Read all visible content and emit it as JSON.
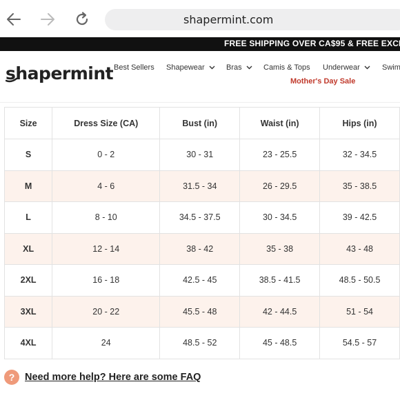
{
  "browser": {
    "url": "shapermint.com",
    "back_icon": "arrow-left-icon",
    "forward_icon": "arrow-right-icon",
    "reload_icon": "reload-icon"
  },
  "promo": {
    "text": "FREE SHIPPING OVER CA$95 & FREE EXCH"
  },
  "header": {
    "logo_text": "shapermint",
    "menu": [
      {
        "label": "Best Sellers",
        "has_dropdown": false
      },
      {
        "label": "Shapewear",
        "has_dropdown": true
      },
      {
        "label": "Bras",
        "has_dropdown": true
      },
      {
        "label": "Camis & Tops",
        "has_dropdown": false
      },
      {
        "label": "Underwear",
        "has_dropdown": true
      },
      {
        "label": "Swim",
        "has_dropdown": false
      }
    ],
    "sale_link": "Mother's Day Sale",
    "sale_color": "#c0392b"
  },
  "table": {
    "headers": [
      "Size",
      "Dress Size (CA)",
      "Bust (in)",
      "Waist (in)",
      "Hips (in)"
    ],
    "rows": [
      [
        "S",
        "0 - 2",
        "30 - 31",
        "23 - 25.5",
        "32 - 34.5"
      ],
      [
        "M",
        "4 - 6",
        "31.5 - 34",
        "26 - 29.5",
        "35 - 38.5"
      ],
      [
        "L",
        "8 - 10",
        "34.5 - 37.5",
        "30 - 34.5",
        "39 - 42.5"
      ],
      [
        "XL",
        "12 - 14",
        "38 - 42",
        "35 - 38",
        "43 - 48"
      ],
      [
        "2XL",
        "16 - 18",
        "42.5 - 45",
        "38.5 - 41.5",
        "48.5 - 50.5"
      ],
      [
        "3XL",
        "20 - 22",
        "45.5 - 48",
        "42 - 44.5",
        "51 - 54"
      ],
      [
        "4XL",
        "24",
        "48.5 - 52",
        "45 - 48.5",
        "54.5 - 57"
      ]
    ],
    "shade_color": "#fdf2ec"
  },
  "faq": {
    "icon_glyph": "?",
    "icon_color": "#ef9a7a",
    "link_text": "Need more help? Here are some FAQ"
  }
}
